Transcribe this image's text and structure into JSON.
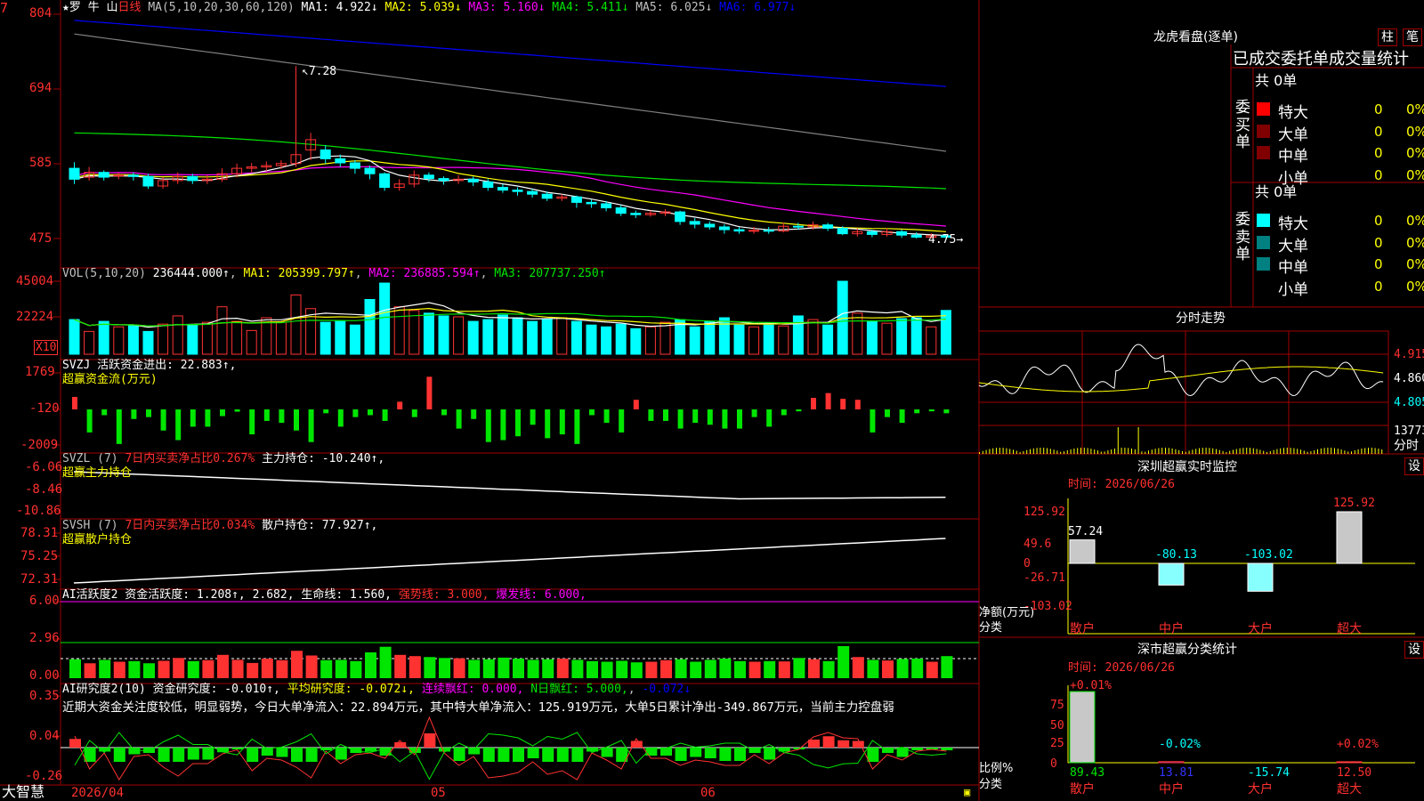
{
  "stock": {
    "name": "罗 牛 山",
    "period": "日线",
    "ma_header": "MA(5,10,20,30,60,120)",
    "ma_values": [
      "MA1: 4.922↓",
      "MA2: 5.039↓",
      "MA3: 5.160↓",
      "MA4: 5.411↓",
      "MA5: 6.025↓",
      "MA6: 6.977↓"
    ],
    "high_marker": "7.28",
    "low_marker": "4.75"
  },
  "colors": {
    "up": "#ff3232",
    "down": "#00ffff",
    "ma1": "#ffffff",
    "ma2": "#ffff00",
    "ma3": "#ff00ff",
    "ma4": "#00e600",
    "ma5": "#808080",
    "ma6": "#0000ff",
    "frame": "#a00000",
    "axis": "#ff3030"
  },
  "panels": {
    "vol": {
      "header": "VOL(5,10,20)",
      "value": "236444.000↑",
      "ma1": "MA1: 205399.797↑",
      "ma2": "MA2: 236885.594↑",
      "ma3": "MA3: 207737.250↑",
      "unit": "X10"
    },
    "svzj": {
      "header": "SVZJ  活跃资金进出: 22.883↑,",
      "sub": "超赢资金流(万元)"
    },
    "svzl": {
      "header": "SVZL (7)",
      "ratio": "7日内买卖净占比0.267%",
      "hold": "主力持仓: -10.240↑,",
      "sub": "超赢主力持仓"
    },
    "svsh": {
      "header": "SVSH (7)",
      "ratio": "7日内买卖净占比0.034%",
      "hold": "散户持仓: 77.927↑,",
      "sub": "超赢散户持仓"
    },
    "ai1": {
      "header": "AI活跃度2 资金活跃度: 1.208↑, 2.682, 生命线: 1.560,",
      "strong": "强势线: 3.000,",
      "burst": "爆发线: 6.000,"
    },
    "ai2": {
      "header": "AI研究度2(10) 资金研究度: -0.010↑,",
      "avg": "平均研究度: -0.072↓,",
      "red": "连续飘红: 0.000,",
      "nred": "N日飘红: 5.000,",
      "last": "-0.072↓",
      "text": "近期大资金关注度较低，明显弱势，今日大单净流入：22.894万元，其中特大单净流入：125.919万元，大单5日累计净出-349.867万元，当前主力控盘弱"
    }
  },
  "axis_labels": {
    "price": [
      "804",
      "694",
      "585",
      "475"
    ],
    "vol": [
      "45004",
      "22224"
    ],
    "svzj": [
      "1769",
      "-120",
      "-2009"
    ],
    "svzl": [
      "-6.06",
      "-8.46",
      "-10.86"
    ],
    "svsh": [
      "78.31",
      "75.25",
      "72.31"
    ],
    "ai1": [
      "6.00",
      "2.96",
      "0.00"
    ],
    "ai2": [
      "0.35",
      "0.04",
      "-0.26"
    ],
    "dates": [
      "2026/04",
      "05",
      "06"
    ]
  },
  "footer": {
    "brand": "大智慧"
  },
  "right": {
    "dragon": {
      "title": "龙虎看盘(逐单)",
      "btn1": "柱",
      "btn2": "笔",
      "subtitle": "已成交委托单成交量统计",
      "buy_label": "委买单",
      "sell_label": "委卖单",
      "buy_total": "共 0单",
      "sell_total": "共 0单",
      "rows": [
        {
          "name": "特大",
          "value": "0",
          "pct": "0%"
        },
        {
          "name": "大单",
          "value": "0",
          "pct": "0%"
        },
        {
          "name": "中单",
          "value": "0",
          "pct": "0%"
        },
        {
          "name": "小单",
          "value": "0",
          "pct": "0%"
        }
      ]
    },
    "intraday": {
      "title": "分时走势",
      "p1": "4.915",
      "p2": "4.860",
      "p3": "4.805",
      "vol": "13773",
      "vol2": "分时"
    },
    "monitor": {
      "title": "深圳超赢实时监控",
      "btn": "设",
      "time": "时间: 2026/06/26",
      "y": [
        "125.92",
        "49.6",
        "0",
        "-26.71",
        "-103.02"
      ],
      "ylabel": "净额(万元)",
      "xlabel": "分类",
      "cats": [
        "散户",
        "中户",
        "大户",
        "超大"
      ],
      "values": [
        "57.24",
        "-80.13",
        "-103.02",
        "125.92"
      ]
    },
    "classify": {
      "title": "深市超赢分类统计",
      "btn": "设",
      "time": "时间: 2026/06/26",
      "y": [
        "75",
        "50",
        "25",
        "0"
      ],
      "ylabel": "比例%",
      "xlabel": "分类",
      "cats": [
        "散户",
        "中户",
        "大户",
        "超大"
      ],
      "top": [
        "+0.01%",
        "-0.02%",
        "",
        "+0.02%"
      ],
      "bottom": [
        "89.43",
        "13.81",
        "-15.74",
        "12.50"
      ]
    }
  },
  "chart_data": {
    "type": "candlestick",
    "dates": [
      "2026/04",
      "05",
      "06"
    ],
    "price_axis": [
      475,
      804
    ],
    "ohlc": [
      [
        5.78,
        5.62,
        5.87,
        5.55
      ],
      [
        5.65,
        5.72,
        5.8,
        5.6
      ],
      [
        5.72,
        5.65,
        5.75,
        5.6
      ],
      [
        5.67,
        5.68,
        5.72,
        5.62
      ],
      [
        5.68,
        5.66,
        5.72,
        5.6
      ],
      [
        5.66,
        5.52,
        5.7,
        5.48
      ],
      [
        5.52,
        5.6,
        5.65,
        5.48
      ],
      [
        5.6,
        5.66,
        5.72,
        5.55
      ],
      [
        5.66,
        5.6,
        5.7,
        5.55
      ],
      [
        5.6,
        5.62,
        5.68,
        5.55
      ],
      [
        5.62,
        5.7,
        5.78,
        5.58
      ],
      [
        5.7,
        5.78,
        5.85,
        5.65
      ],
      [
        5.78,
        5.8,
        5.86,
        5.72
      ],
      [
        5.8,
        5.82,
        5.88,
        5.74
      ],
      [
        5.82,
        5.85,
        5.9,
        5.77
      ],
      [
        5.85,
        5.98,
        7.28,
        5.8
      ],
      [
        6.05,
        6.2,
        6.3,
        5.9
      ],
      [
        6.05,
        5.92,
        6.12,
        5.85
      ],
      [
        5.92,
        5.86,
        5.98,
        5.8
      ],
      [
        5.86,
        5.78,
        5.9,
        5.7
      ],
      [
        5.78,
        5.7,
        5.82,
        5.62
      ],
      [
        5.7,
        5.5,
        5.72,
        5.45
      ],
      [
        5.5,
        5.55,
        5.62,
        5.45
      ],
      [
        5.55,
        5.68,
        5.75,
        5.5
      ],
      [
        5.68,
        5.63,
        5.72,
        5.58
      ],
      [
        5.63,
        5.6,
        5.66,
        5.54
      ],
      [
        5.6,
        5.62,
        5.68,
        5.55
      ],
      [
        5.62,
        5.58,
        5.66,
        5.52
      ],
      [
        5.58,
        5.5,
        5.62,
        5.45
      ],
      [
        5.5,
        5.46,
        5.55,
        5.42
      ],
      [
        5.46,
        5.44,
        5.5,
        5.38
      ],
      [
        5.44,
        5.4,
        5.48,
        5.35
      ],
      [
        5.4,
        5.34,
        5.44,
        5.3
      ],
      [
        5.34,
        5.36,
        5.4,
        5.3
      ],
      [
        5.36,
        5.28,
        5.38,
        5.2
      ],
      [
        5.28,
        5.26,
        5.32,
        5.2
      ],
      [
        5.26,
        5.2,
        5.3,
        5.15
      ],
      [
        5.2,
        5.12,
        5.24,
        5.08
      ],
      [
        5.12,
        5.1,
        5.16,
        5.05
      ],
      [
        5.1,
        5.12,
        5.16,
        5.07
      ],
      [
        5.12,
        5.14,
        5.18,
        5.08
      ],
      [
        5.14,
        5.0,
        5.16,
        4.95
      ],
      [
        5.0,
        4.96,
        5.05,
        4.9
      ],
      [
        4.96,
        4.92,
        5.0,
        4.88
      ],
      [
        4.92,
        4.88,
        4.96,
        4.82
      ],
      [
        4.88,
        4.86,
        4.92,
        4.82
      ],
      [
        4.86,
        4.87,
        4.92,
        4.82
      ],
      [
        4.87,
        4.86,
        4.92,
        4.82
      ],
      [
        4.86,
        4.93,
        4.98,
        4.84
      ],
      [
        4.93,
        4.92,
        4.98,
        4.88
      ],
      [
        4.92,
        4.95,
        5.0,
        4.88
      ],
      [
        4.95,
        4.9,
        4.98,
        4.86
      ],
      [
        4.9,
        4.82,
        4.93,
        4.8
      ],
      [
        4.82,
        4.85,
        4.9,
        4.78
      ],
      [
        4.85,
        4.81,
        4.88,
        4.77
      ],
      [
        4.81,
        4.85,
        4.9,
        4.78
      ],
      [
        4.85,
        4.8,
        4.88,
        4.76
      ],
      [
        4.8,
        4.77,
        4.84,
        4.75
      ],
      [
        4.77,
        4.79,
        4.83,
        4.75
      ],
      [
        4.79,
        4.77,
        4.8,
        4.75
      ]
    ],
    "volume": [
      38000,
      25000,
      36000,
      30000,
      32000,
      25000,
      33000,
      42000,
      32000,
      35000,
      52000,
      36000,
      26000,
      40000,
      35000,
      65000,
      50000,
      35000,
      36000,
      32000,
      60000,
      78000,
      52000,
      48000,
      45000,
      42000,
      41000,
      36000,
      38000,
      43000,
      40000,
      36000,
      38000,
      40000,
      36000,
      32000,
      30000,
      33000,
      28000,
      30000,
      35000,
      38000,
      30000,
      36000,
      40000,
      32000,
      30000,
      32000,
      31000,
      42000,
      38000,
      32000,
      80000,
      45000,
      36000,
      34000,
      39000,
      40000,
      30000,
      48000
    ],
    "svzj": [
      650,
      -1200,
      -300,
      -1800,
      -500,
      -400,
      -1100,
      -1600,
      -900,
      -900,
      -350,
      -120,
      -1300,
      -600,
      -700,
      -1100,
      -1700,
      -200,
      -900,
      -400,
      -300,
      -600,
      400,
      -400,
      1700,
      -300,
      -1000,
      -500,
      -1700,
      -1600,
      -1400,
      -800,
      -1500,
      -1300,
      -1800,
      -300,
      -700,
      -1200,
      500,
      -600,
      -600,
      -1000,
      -700,
      -800,
      -1000,
      -1000,
      -400,
      -900,
      -300,
      -100,
      600,
      850,
      550,
      500,
      -1200,
      -400,
      -700,
      -200,
      -100,
      -200
    ],
    "ma_end_values": {
      "MA1": 4.922,
      "MA2": 5.039,
      "MA3": 5.16,
      "MA4": 5.411,
      "MA5": 6.025,
      "MA6": 6.977
    }
  }
}
